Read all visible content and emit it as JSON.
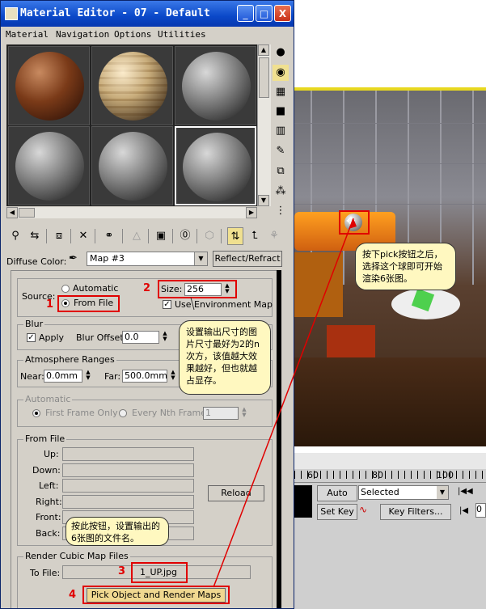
{
  "window": {
    "title": "Material Editor - 07 - Default",
    "min": "_",
    "max": "□",
    "close": "X"
  },
  "menu": [
    "Material",
    "Navigation",
    "Options",
    "Utilities"
  ],
  "slots": [
    {
      "type": "wood",
      "icon": "wood-sphere"
    },
    {
      "type": "planks",
      "icon": "plank-sphere"
    },
    {
      "type": "gray",
      "icon": "gray-sphere"
    },
    {
      "type": "gray",
      "icon": "gray-sphere"
    },
    {
      "type": "gray",
      "icon": "gray-sphere"
    },
    {
      "type": "gray",
      "icon": "gray-sphere"
    }
  ],
  "diffuse": {
    "label": "Diffuse Color:",
    "map": "Map #3",
    "reflect_button": "Reflect/Refract"
  },
  "source": {
    "label": "Source:",
    "automatic": "Automatic",
    "from_file": "From File",
    "size_label": "Size:",
    "size_value": "256",
    "use_env": "Use Environment Map"
  },
  "blur": {
    "title": "Blur",
    "apply": "Apply",
    "offset_label": "Blur Offset:",
    "offset_value": "0.0"
  },
  "atmos": {
    "title": "Atmosphere Ranges",
    "near_label": "Near:",
    "near_value": "0.0mm",
    "far_label": "Far:",
    "far_value": "500.0mm"
  },
  "automatic": {
    "title": "Automatic",
    "first_frame": "First Frame Only",
    "every_nth": "Every Nth Frame:",
    "nth_value": "1"
  },
  "from_file": {
    "title": "From File",
    "labels": [
      "Up:",
      "Down:",
      "Left:",
      "Right:",
      "Front:",
      "Back:"
    ],
    "reload": "Reload"
  },
  "render_cubic": {
    "title": "Render Cubic Map Files",
    "to_file_label": "To File:",
    "to_file_value": "1_UP.jpg",
    "pick_button": "Pick Object and Render Maps"
  },
  "annotations": {
    "n1": "1",
    "n2": "2",
    "n3": "3",
    "n4": "4"
  },
  "callouts": {
    "size": "设置输出尺寸的图片尺寸最好为2的n次方，该值越大效果越好，但也就越占显存。",
    "file": "按此按钮，设置输出的6张图的文件名。",
    "pick": "按下pick按钮之后，选择这个球即可开始渲染6张图。"
  },
  "timeline": {
    "ticks": [
      "60",
      "80",
      "100"
    ],
    "auto_key": "Auto Key",
    "selected": "Selected",
    "set_key": "Set Key",
    "key_filters": "Key Filters...",
    "frame": "0"
  },
  "colors": {
    "annotation_red": "#e00000",
    "callout_bg": "#fff8c0",
    "title_blue": "#0a48c8"
  }
}
